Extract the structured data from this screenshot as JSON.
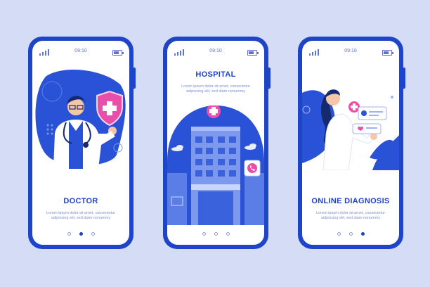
{
  "status_bar": {
    "time": "09:10"
  },
  "screens": [
    {
      "title": "DOCTOR",
      "description": "Lorem ipsum dolor sit amet, consectetur adipiscing elit, sed diam nonummy",
      "illustration_icon": "doctor-shield-icon"
    },
    {
      "title": "HOSPITAL",
      "description": "Lorem ipsum dolor sit amet, consectetur adipiscing elit, sed diam nonummy",
      "illustration_icon": "hospital-building-icon"
    },
    {
      "title": "ONLINE DIAGNOSIS",
      "description": "Lorem ipsum dolor sit amet, consectetur adipiscing elit, sed diam nonummy",
      "illustration_icon": "online-diagnosis-icon"
    }
  ],
  "colors": {
    "primary": "#1e44c8",
    "accent_pink": "#e94fa8",
    "background": "#d4dcf6",
    "light_blue": "#7d8ed6"
  }
}
